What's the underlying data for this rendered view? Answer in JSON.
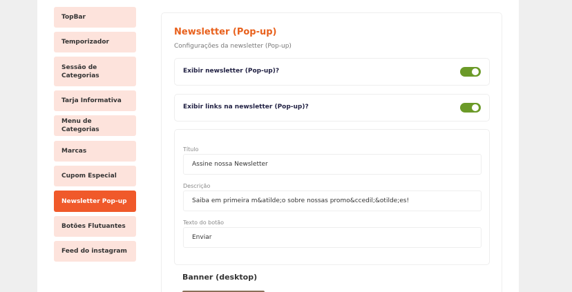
{
  "sidebar": {
    "items": [
      {
        "label": "TopBar"
      },
      {
        "label": "Temporizador"
      },
      {
        "label": "Sessão de Categorias"
      },
      {
        "label": "Tarja Informativa"
      },
      {
        "label": "Menu de Categorias"
      },
      {
        "label": "Marcas"
      },
      {
        "label": "Cupom Especial"
      },
      {
        "label": "Newsletter Pop-up",
        "active": true
      },
      {
        "label": "Botões Flutuantes"
      },
      {
        "label": "Feed do instagram"
      }
    ]
  },
  "main": {
    "title": "Newsletter (Pop-up)",
    "subtitle": "Configurações da newsletter (Pop-up)",
    "toggles": [
      {
        "label": "Exibir newsletter (Pop-up)?",
        "on": true
      },
      {
        "label": "Exibir links na newsletter (Pop-up)?",
        "on": true
      }
    ],
    "form": {
      "title_label": "Título",
      "title_value": "Assine nossa Newsletter",
      "description_label": "Descrição",
      "description_value": "Saiba em primeira m&atilde;o sobre nossas promo&ccedil;&otilde;es!",
      "button_text_label": "Texto do botão",
      "button_text_value": "Enviar"
    },
    "banner_title": "Banner (desktop)"
  },
  "colors": {
    "accent": "#f0592a",
    "title": "#e8611d",
    "sidebar_bg": "#fde3dc",
    "toggle_on": "#6b9a28"
  }
}
